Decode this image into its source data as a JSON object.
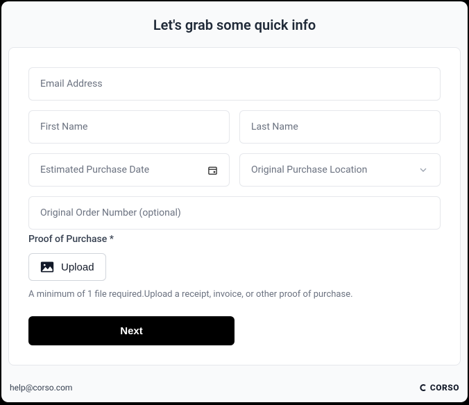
{
  "header": {
    "title": "Let's grab some quick info"
  },
  "form": {
    "email_placeholder": "Email Address",
    "first_name_placeholder": "First Name",
    "last_name_placeholder": "Last Name",
    "purchase_date_placeholder": "Estimated Purchase Date",
    "location_placeholder": "Original Purchase Location",
    "order_number_placeholder": "Original Order Number (optional)",
    "proof_label": "Proof of Purchase *",
    "upload_label": "Upload",
    "proof_hint": "A minimum of 1 file required.Upload a receipt, invoice, or other proof of purchase.",
    "next_label": "Next"
  },
  "footer": {
    "email": "help@corso.com",
    "brand": "CORSO"
  }
}
